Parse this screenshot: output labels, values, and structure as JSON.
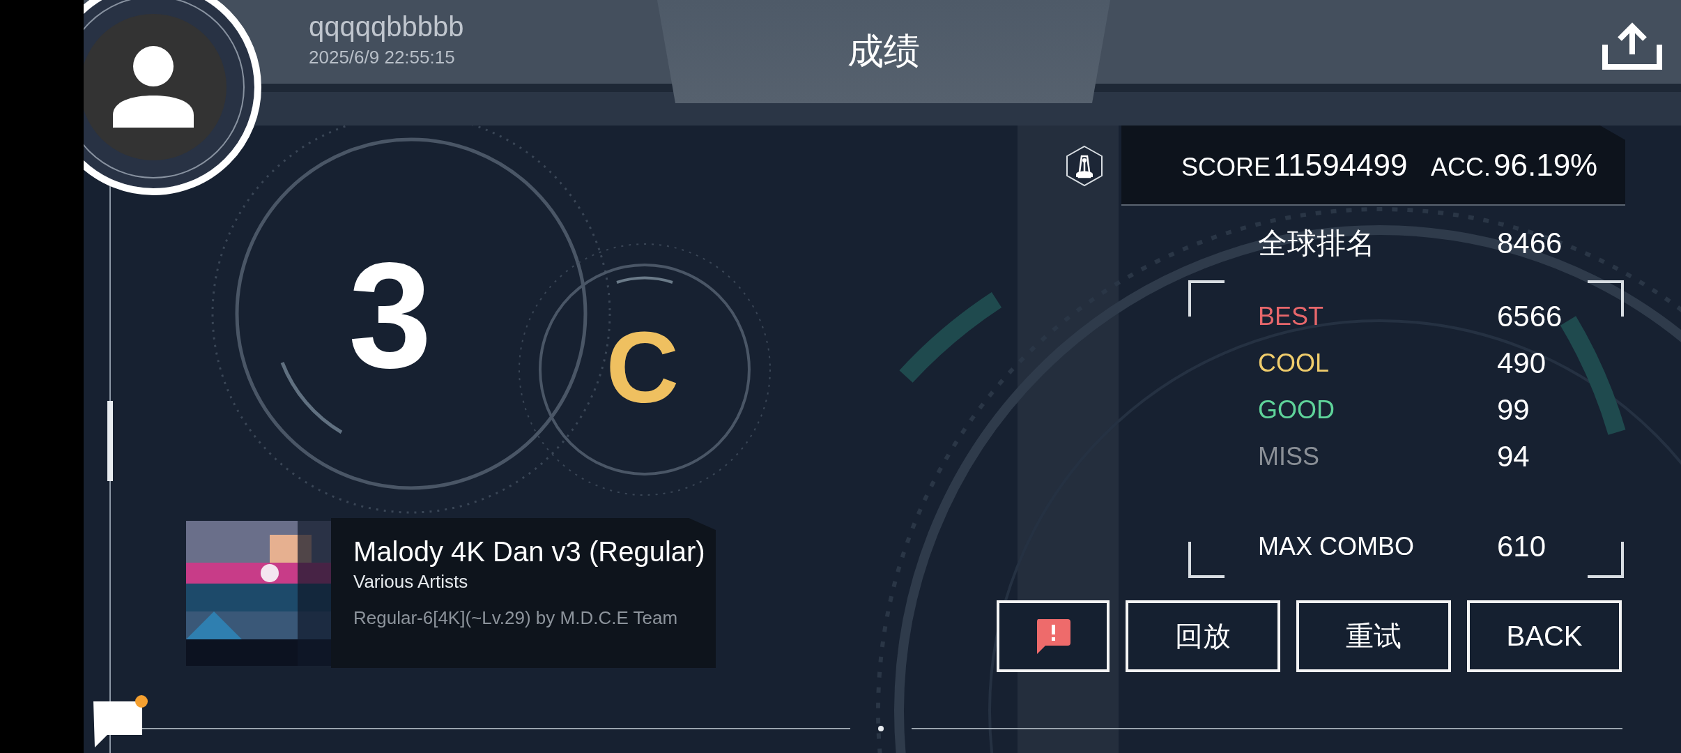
{
  "user": {
    "name": "qqqqqbbbbb",
    "time": "2025/6/9 22:55:15"
  },
  "title": "成绩",
  "score": {
    "label": "SCORE",
    "value": "11594499"
  },
  "acc": {
    "label": "ACC.",
    "value": "96.19%"
  },
  "rank": {
    "label": "全球排名",
    "value": "8466"
  },
  "judgements": [
    {
      "label": "BEST",
      "value": "6566",
      "color": "#e8676b"
    },
    {
      "label": "COOL",
      "value": "490",
      "color": "#f0cd6c"
    },
    {
      "label": "GOOD",
      "value": "99",
      "color": "#5fd39a"
    },
    {
      "label": "MISS",
      "value": "94",
      "color": "#8a8f96"
    }
  ],
  "max_combo": {
    "label": "MAX COMBO",
    "value": "610"
  },
  "grade": {
    "number": "3",
    "letter": "C"
  },
  "song": {
    "title": "Malody 4K Dan v3 (Regular)",
    "artist": "Various Artists",
    "chart": "Regular-6[4K](~Lv.29) by M.D.C.E Team"
  },
  "buttons": [
    {
      "kind": "report"
    },
    {
      "kind": "text",
      "label": "回放"
    },
    {
      "kind": "text",
      "label": "重试"
    },
    {
      "kind": "text",
      "label": "BACK"
    }
  ]
}
